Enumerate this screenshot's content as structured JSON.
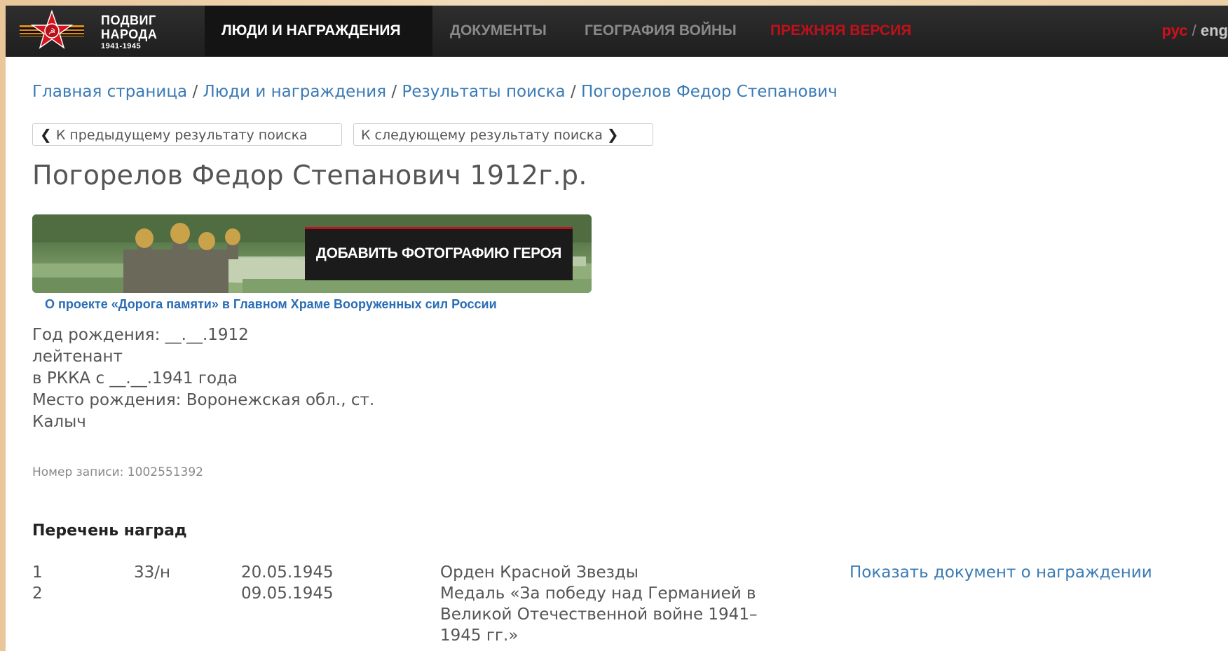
{
  "header": {
    "logo": {
      "line1": "ПОДВИГ",
      "line2": "НАРОДА",
      "line3": "1941-1945"
    },
    "nav": [
      {
        "label": "ЛЮДИ И НАГРАЖДЕНИЯ",
        "active": true
      },
      {
        "label": "ДОКУМЕНТЫ",
        "active": false
      },
      {
        "label": "ГЕОГРАФИЯ ВОЙНЫ",
        "active": false
      },
      {
        "label": "ПРЕЖНЯЯ ВЕРСИЯ",
        "active": false,
        "color": "#c0101a"
      }
    ],
    "lang": {
      "ru": "рус",
      "sep": " / ",
      "en": "eng"
    }
  },
  "breadcrumb": {
    "items": [
      "Главная страница",
      "Люди и награждения",
      "Результаты поиска",
      "Погорелов Федор Степанович"
    ],
    "separator": " / "
  },
  "search_nav": {
    "prev_label": "К предыдущему результату поиска",
    "next_label": "К следующему результату поиска"
  },
  "person": {
    "title": "Погорелов Федор Степанович 1912г.р.",
    "banner_button": "ДОБАВИТЬ ФОТОГРАФИЮ ГЕРОЯ",
    "banner_link": "О проекте «Дорога памяти» в Главном Храме Вооруженных сил России",
    "birth_year": "Год рождения: __.__.1912",
    "rank": "лейтенант",
    "rkka": "в РККА с __.__.1941 года",
    "birth_place_1": "Место рождения: Воронежская обл., ст.",
    "birth_place_2": "Калыч",
    "record_number": "Номер записи: 1002551392"
  },
  "awards": {
    "title": "Перечень наград",
    "rows": [
      {
        "num": "1",
        "doc": "33/н",
        "date": "20.05.1945",
        "name": "Орден Красной Звезды",
        "link": "Показать документ о награждении"
      },
      {
        "num": "2",
        "doc": "",
        "date": "09.05.1945",
        "name": "Медаль «За победу над Германией в Великой Отечественной войне 1941–1945 гг.»",
        "link": ""
      }
    ]
  },
  "colors": {
    "header_bg": "#2a2a2a",
    "link": "#3a7ab5",
    "accent_red": "#c0101a"
  }
}
